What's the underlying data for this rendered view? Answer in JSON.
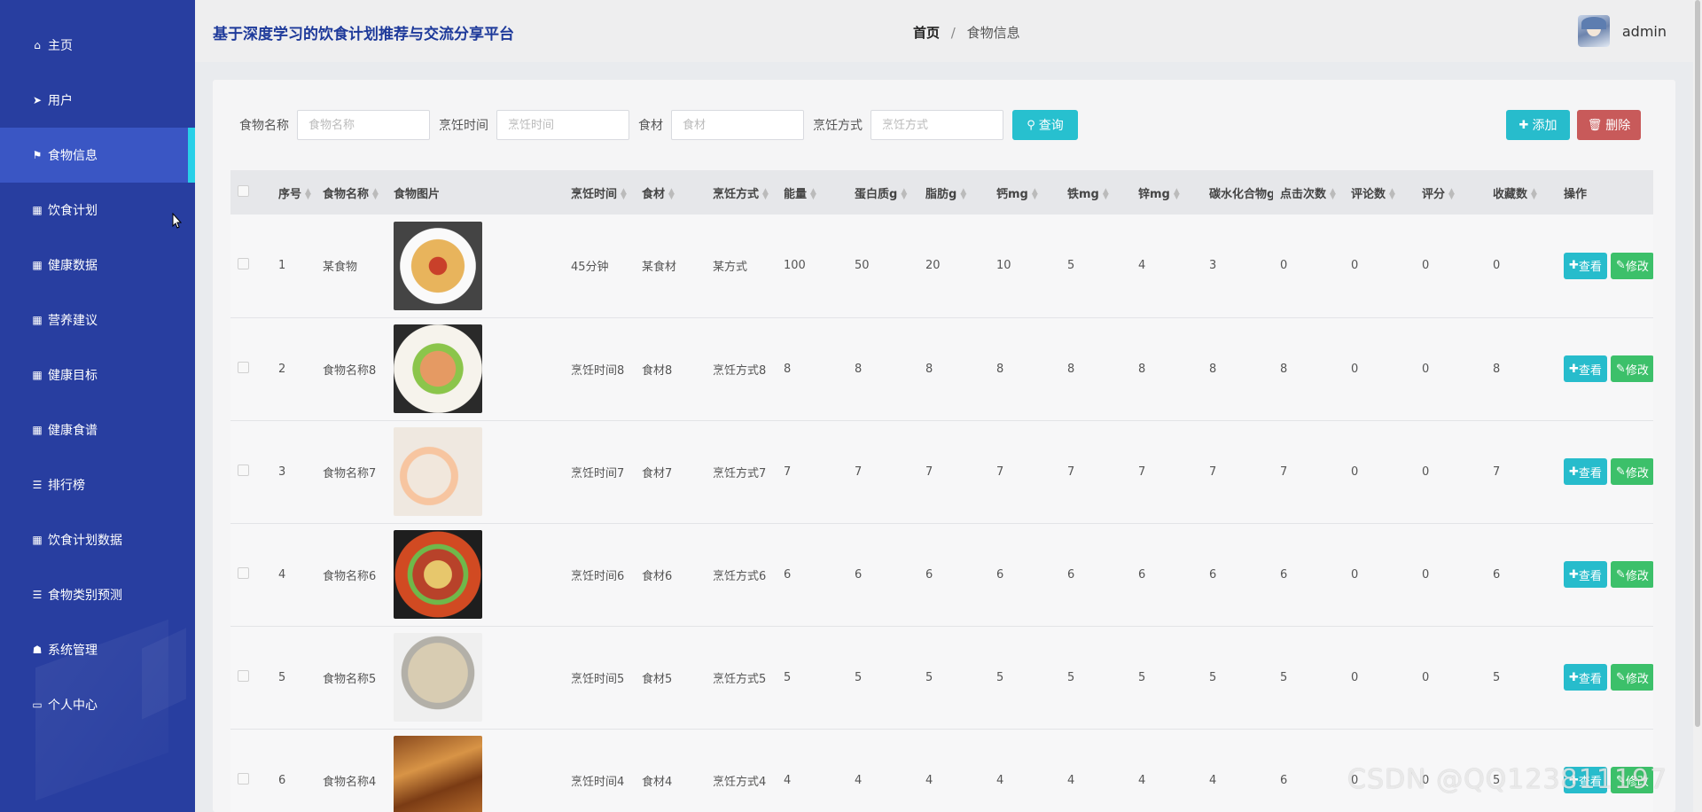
{
  "header": {
    "site_title": "基于深度学习的饮食计划推荐与交流分享平台",
    "breadcrumb_home": "首页",
    "breadcrumb_separator": "/",
    "breadcrumb_current": "食物信息",
    "username": "admin"
  },
  "sidebar": {
    "items": [
      {
        "label": "主页",
        "icon": "home-icon",
        "glyph": "⌂"
      },
      {
        "label": "用户",
        "icon": "send-icon",
        "glyph": "➤"
      },
      {
        "label": "食物信息",
        "icon": "flag-icon",
        "glyph": "⚑",
        "active": true
      },
      {
        "label": "饮食计划",
        "icon": "grid-icon",
        "glyph": "▦"
      },
      {
        "label": "健康数据",
        "icon": "grid-icon",
        "glyph": "▦"
      },
      {
        "label": "营养建议",
        "icon": "grid-icon",
        "glyph": "▦"
      },
      {
        "label": "健康目标",
        "icon": "grid-icon",
        "glyph": "▦"
      },
      {
        "label": "健康食谱",
        "icon": "grid-icon",
        "glyph": "▦"
      },
      {
        "label": "排行榜",
        "icon": "list-icon",
        "glyph": "☰"
      },
      {
        "label": "饮食计划数据",
        "icon": "grid-icon",
        "glyph": "▦"
      },
      {
        "label": "食物类别预测",
        "icon": "list-icon",
        "glyph": "☰"
      },
      {
        "label": "系统管理",
        "icon": "thumbs-down-icon",
        "glyph": "☗"
      },
      {
        "label": "个人中心",
        "icon": "card-icon",
        "glyph": "▭"
      }
    ]
  },
  "search": {
    "food_name_label": "食物名称",
    "food_name_placeholder": "食物名称",
    "cook_time_label": "烹饪时间",
    "cook_time_placeholder": "烹饪时间",
    "ingredient_label": "食材",
    "ingredient_placeholder": "食材",
    "cook_method_label": "烹饪方式",
    "cook_method_placeholder": "烹饪方式",
    "search_button": "查询"
  },
  "actions": {
    "add_button": "添加",
    "delete_button": "删除",
    "view_button": "查看",
    "edit_button": "修改"
  },
  "table": {
    "headers": [
      "序号",
      "食物名称",
      "食物图片",
      "烹饪时间",
      "食材",
      "烹饪方式",
      "能量",
      "蛋白质g",
      "脂肪g",
      "钙mg",
      "铁mg",
      "锌mg",
      "碳水化合物g",
      "点击次数",
      "评论数",
      "评分",
      "收藏数",
      "操作"
    ],
    "rows": [
      {
        "index": "1",
        "name": "某食物",
        "image": "meatball-pasta",
        "time": "45分钟",
        "ingredient": "某食材",
        "method": "某方式",
        "energy": "100",
        "protein": "50",
        "fat": "20",
        "calcium": "10",
        "iron": "5",
        "zinc": "4",
        "carbs": "3",
        "clicks": "0",
        "comments": "0",
        "rating": "0",
        "favorites": "0"
      },
      {
        "index": "2",
        "name": "食物名称8",
        "image": "sliced-fish-platter",
        "time": "烹饪时间8",
        "ingredient": "食材8",
        "method": "烹饪方式8",
        "energy": "8",
        "protein": "8",
        "fat": "8",
        "calcium": "8",
        "iron": "8",
        "zinc": "8",
        "carbs": "8",
        "clicks": "8",
        "comments": "0",
        "rating": "0",
        "favorites": "8"
      },
      {
        "index": "3",
        "name": "食物名称7",
        "image": "shrimp-dumplings",
        "time": "烹饪时间7",
        "ingredient": "食材7",
        "method": "烹饪方式7",
        "energy": "7",
        "protein": "7",
        "fat": "7",
        "calcium": "7",
        "iron": "7",
        "zinc": "7",
        "carbs": "7",
        "clicks": "7",
        "comments": "0",
        "rating": "0",
        "favorites": "7"
      },
      {
        "index": "4",
        "name": "食物名称6",
        "image": "beef-noodle-soup",
        "time": "烹饪时间6",
        "ingredient": "食材6",
        "method": "烹饪方式6",
        "energy": "6",
        "protein": "6",
        "fat": "6",
        "calcium": "6",
        "iron": "6",
        "zinc": "6",
        "carbs": "6",
        "clicks": "6",
        "comments": "0",
        "rating": "0",
        "favorites": "6"
      },
      {
        "index": "5",
        "name": "食物名称5",
        "image": "grain-bowl",
        "time": "烹饪时间5",
        "ingredient": "食材5",
        "method": "烹饪方式5",
        "energy": "5",
        "protein": "5",
        "fat": "5",
        "calcium": "5",
        "iron": "5",
        "zinc": "5",
        "carbs": "5",
        "clicks": "5",
        "comments": "0",
        "rating": "0",
        "favorites": "5"
      },
      {
        "index": "6",
        "name": "食物名称4",
        "image": "braised-meat",
        "time": "烹饪时间4",
        "ingredient": "食材4",
        "method": "烹饪方式4",
        "energy": "4",
        "protein": "4",
        "fat": "4",
        "calcium": "4",
        "iron": "4",
        "zinc": "4",
        "carbs": "4",
        "clicks": "6",
        "comments": "0",
        "rating": "0",
        "favorites": "5"
      }
    ]
  },
  "watermark": "CSDN @QQ123811197",
  "colors": {
    "sidebar_bg": "#283ea0",
    "sidebar_active": "#3a56c4",
    "accent_cyan": "#27bccc",
    "danger": "#c85a5a",
    "success": "#3cc06a",
    "title_blue": "#1e3a9a"
  }
}
